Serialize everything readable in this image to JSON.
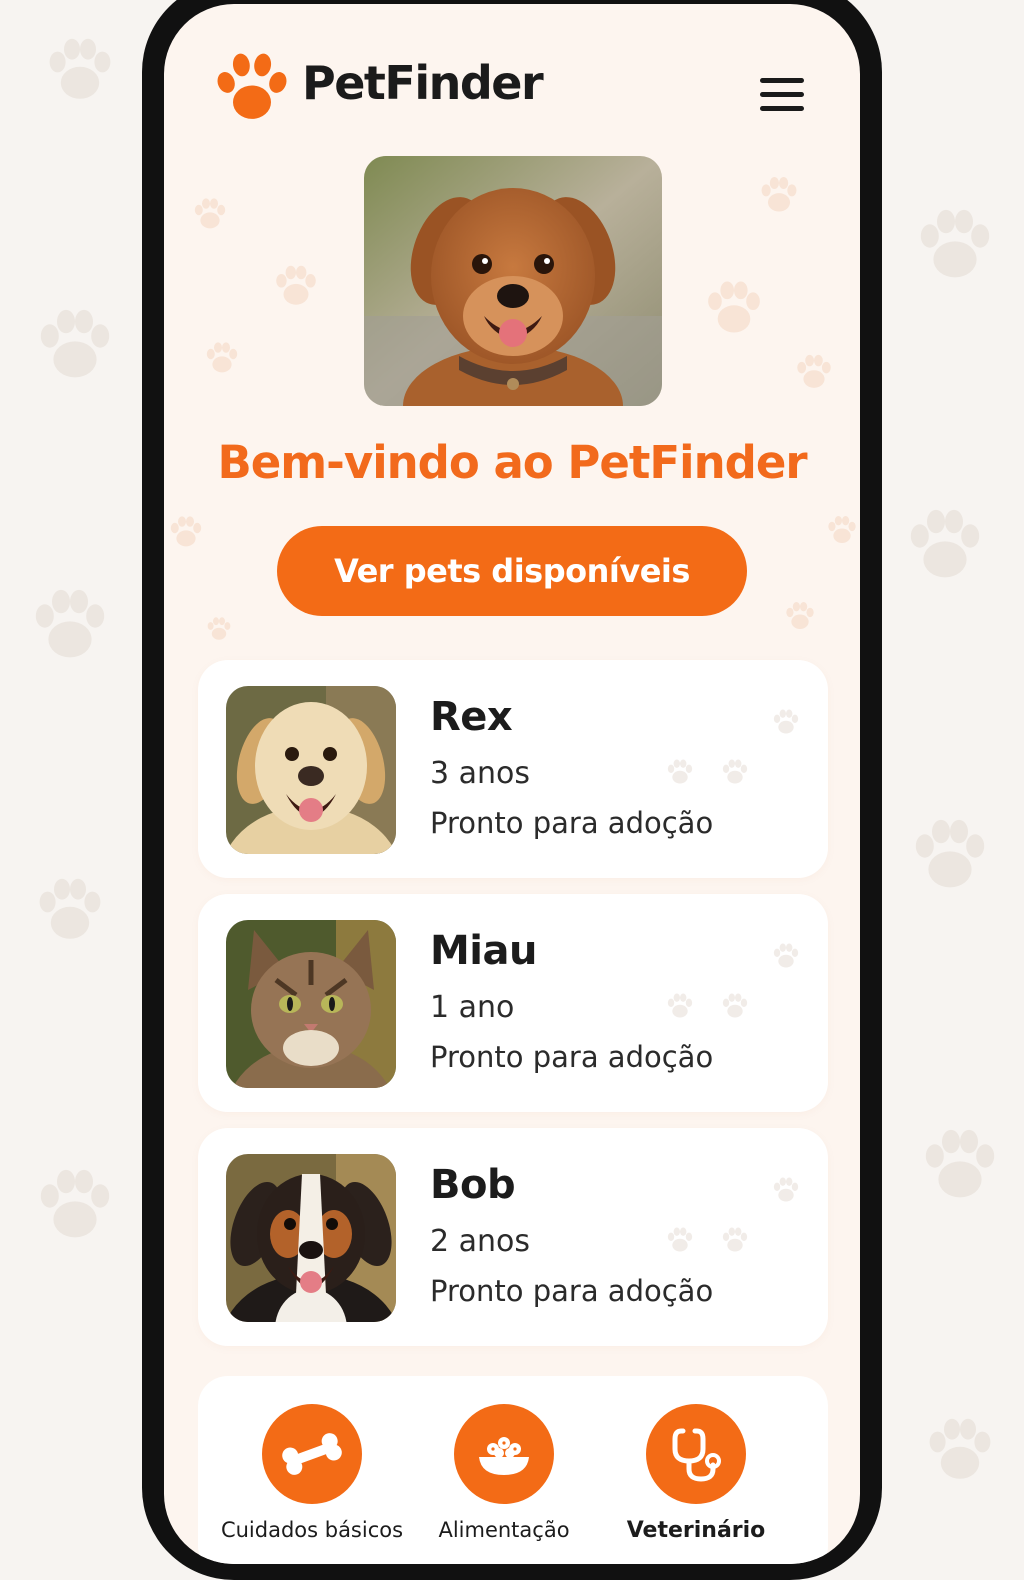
{
  "app": {
    "brand": "PetFinder",
    "accent_color": "#f36b16"
  },
  "header": {
    "logo_icon": "paw-icon",
    "menu_icon": "hamburger-menu-icon"
  },
  "hero": {
    "photo": "small brown fluffy dog with collar",
    "welcome_text": "Bem-vindo ao PetFinder",
    "cta_label": "Ver pets disponíveis"
  },
  "pets": [
    {
      "name": "Rex",
      "age": "3 anos",
      "status": "Pronto para adoção",
      "photo": "golden labrador"
    },
    {
      "name": "Miau",
      "age": "1 ano",
      "status": "Pronto para adoção",
      "photo": "tabby cat"
    },
    {
      "name": "Bob",
      "age": "2 anos",
      "status": "Pronto para adoção",
      "photo": "tricolor dog"
    }
  ],
  "bottom_nav": [
    {
      "label": "Cuidados básicos",
      "icon": "bone-icon"
    },
    {
      "label": "Alimentação",
      "icon": "food-bowl-icon"
    },
    {
      "label": "Veterinário",
      "icon": "stethoscope-icon"
    }
  ]
}
